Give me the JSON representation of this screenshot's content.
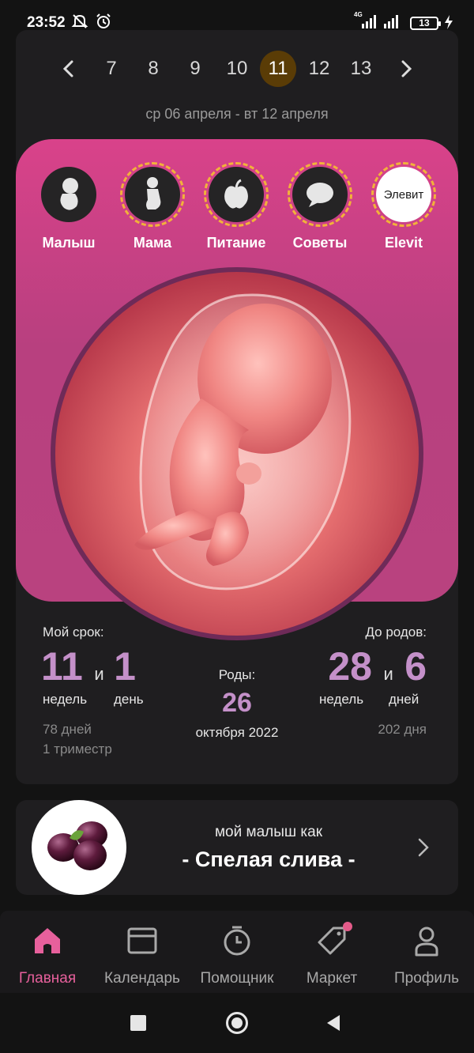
{
  "status_bar": {
    "time": "23:52",
    "network": "4G",
    "battery": "13"
  },
  "week_selector": {
    "weeks": [
      "7",
      "8",
      "9",
      "10",
      "11",
      "12",
      "13"
    ],
    "active_week": "11",
    "date_range": "ср 06 апреля - вт 12 апреля"
  },
  "categories": [
    {
      "label": "Малыш",
      "icon": "baby-icon"
    },
    {
      "label": "Мама",
      "icon": "mother-icon"
    },
    {
      "label": "Питание",
      "icon": "apple-icon"
    },
    {
      "label": "Советы",
      "icon": "chat-icon"
    },
    {
      "label": "Elevit",
      "badge": "Элевит"
    }
  ],
  "term": {
    "title": "Мой срок:",
    "weeks": "11",
    "and": "и",
    "days": "1",
    "weeks_unit": "недель",
    "days_unit": "день",
    "total_days": "78 дней",
    "trimester": "1 триместр"
  },
  "birth": {
    "title": "Роды:",
    "day": "26",
    "month_year": "октября 2022"
  },
  "until_birth": {
    "title": "До родов:",
    "weeks": "28",
    "and": "и",
    "days": "6",
    "weeks_unit": "недель",
    "days_unit": "дней",
    "total_days": "202 дня"
  },
  "fruit": {
    "subtitle": "мой малыш как",
    "title": "- Спелая слива -"
  },
  "bottom_nav": [
    {
      "label": "Главная",
      "icon": "home-icon",
      "active": true
    },
    {
      "label": "Календарь",
      "icon": "calendar-icon"
    },
    {
      "label": "Помощник",
      "icon": "timer-icon"
    },
    {
      "label": "Маркет",
      "icon": "tag-icon"
    },
    {
      "label": "Профиль",
      "icon": "profile-icon"
    }
  ],
  "colors": {
    "accent_pink": "#e7609c",
    "panel_pink": "#c6437f",
    "active_week_bg": "#5a3c06",
    "stat_purple": "#c490c9",
    "dash_orange": "#f2b23a"
  }
}
